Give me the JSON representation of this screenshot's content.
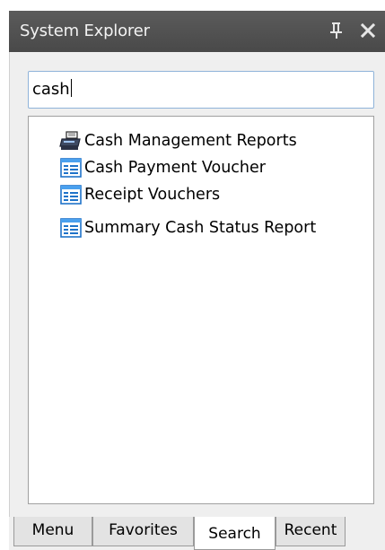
{
  "panel": {
    "title": "System Explorer",
    "pin_icon": "pin-icon",
    "close_icon": "close-icon"
  },
  "search": {
    "value": "cash"
  },
  "results": [
    {
      "label": "Cash Management Reports",
      "icon": "printer-report-icon"
    },
    {
      "label": "Cash Payment Voucher",
      "icon": "form-icon"
    },
    {
      "label": "Receipt Vouchers",
      "icon": "form-icon"
    },
    {
      "label": "Summary Cash Status Report",
      "icon": "form-icon"
    }
  ],
  "tabs": [
    {
      "label": "Menu",
      "active": false
    },
    {
      "label": "Favorites",
      "active": false
    },
    {
      "label": "Search",
      "active": true
    },
    {
      "label": "Recent",
      "active": false
    }
  ],
  "colors": {
    "titlebar": "#494949",
    "accent_border": "#8fb3d9"
  }
}
